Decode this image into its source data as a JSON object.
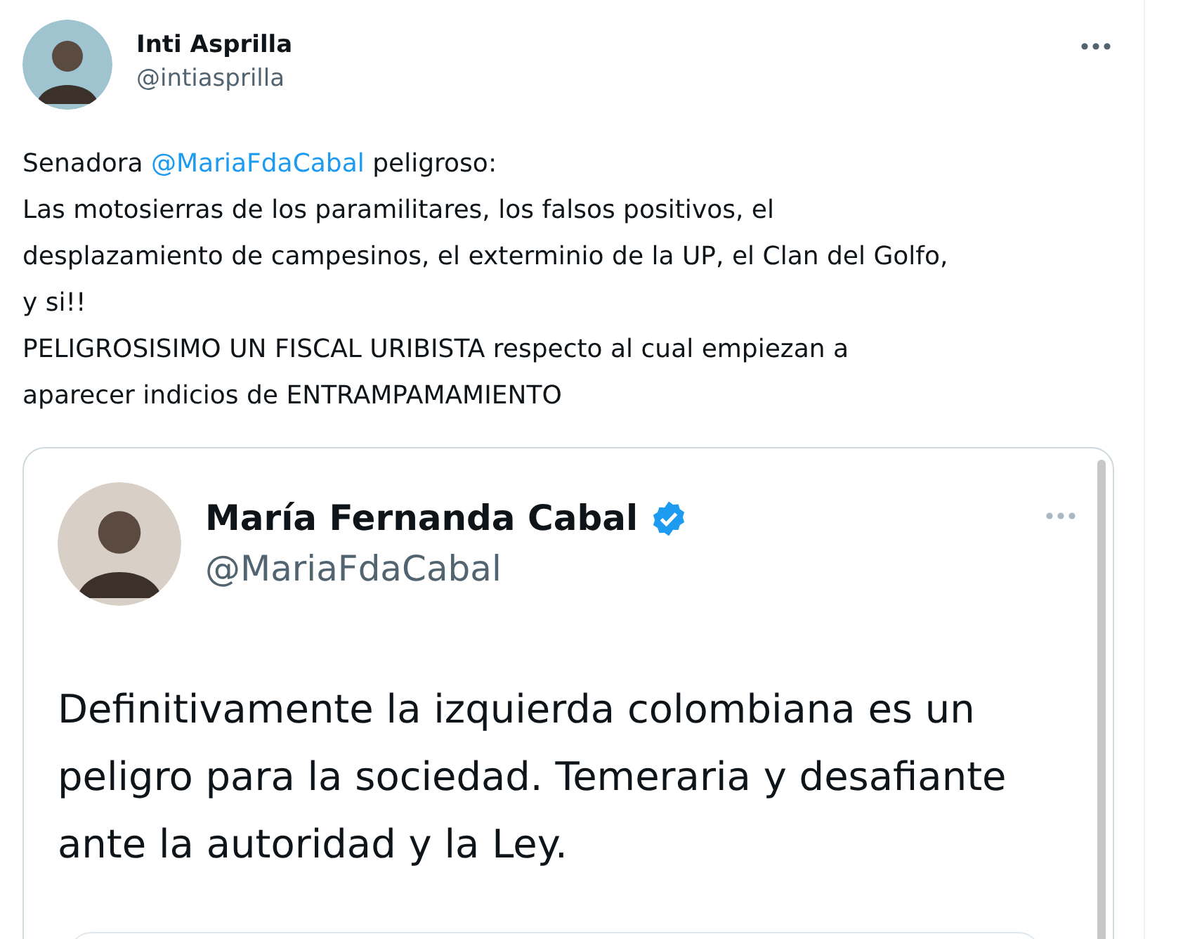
{
  "tweet": {
    "author": {
      "name": "Inti Asprilla",
      "handle": "@intiasprilla"
    },
    "body": [
      {
        "parts": [
          {
            "kind": "text",
            "text": "Senadora "
          },
          {
            "kind": "mention",
            "text": "@MariaFdaCabal"
          },
          {
            "kind": "text",
            "text": " peligroso:"
          }
        ]
      },
      {
        "parts": [
          {
            "kind": "text",
            "text": "Las motosierras de los paramilitares, los falsos positivos, el"
          }
        ]
      },
      {
        "parts": [
          {
            "kind": "text",
            "text": "desplazamiento de campesinos, el exterminio de la UP, el Clan del Golfo,"
          }
        ]
      },
      {
        "parts": [
          {
            "kind": "text",
            "text": "y si!!"
          }
        ]
      },
      {
        "parts": [
          {
            "kind": "text",
            "text": "PELIGROSISIMO UN FISCAL URIBISTA respecto al cual empiezan a"
          }
        ]
      },
      {
        "parts": [
          {
            "kind": "text",
            "text": "aparecer indicios de ENTRAMPAMAMIENTO"
          }
        ]
      }
    ],
    "quoted": {
      "name": "María Fernanda Cabal",
      "verified": true,
      "handle": "@MariaFdaCabal",
      "lines": [
        "Definitivamente la izquierda colombiana es un",
        "peligro para la sociedad. Temeraria y desafiante",
        "ante la autoridad y la Ley."
      ]
    }
  }
}
